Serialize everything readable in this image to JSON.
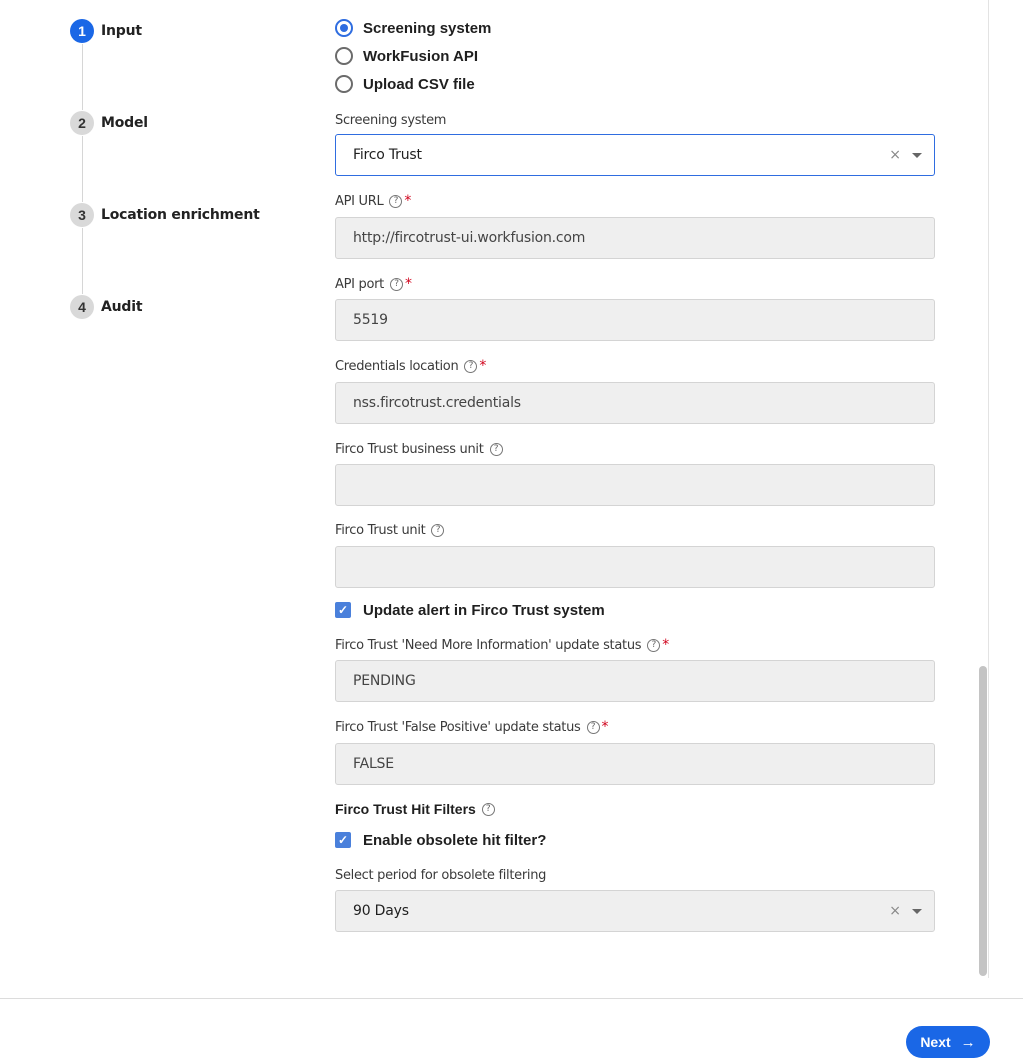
{
  "stepper": {
    "steps": [
      {
        "number": "1",
        "label": "Input",
        "active": true
      },
      {
        "number": "2",
        "label": "Model",
        "active": false
      },
      {
        "number": "3",
        "label": "Location enrichment",
        "active": false
      },
      {
        "number": "4",
        "label": "Audit",
        "active": false
      }
    ]
  },
  "source": {
    "options": [
      {
        "label": "Screening system",
        "selected": true
      },
      {
        "label": "WorkFusion API",
        "selected": false
      },
      {
        "label": "Upload CSV file",
        "selected": false
      }
    ]
  },
  "fields": {
    "screening_system": {
      "label": "Screening system",
      "value": "Firco Trust"
    },
    "api_url": {
      "label": "API URL",
      "value": "http://fircotrust-ui.workfusion.com",
      "required": "*"
    },
    "api_port": {
      "label": "API port",
      "value": "5519",
      "required": "*"
    },
    "credentials": {
      "label": "Credentials location",
      "value": "nss.fircotrust.credentials",
      "required": "*"
    },
    "business_unit": {
      "label": "Firco Trust business unit",
      "value": ""
    },
    "unit": {
      "label": "Firco Trust unit",
      "value": ""
    },
    "update_alert": {
      "label": "Update alert in Firco Trust system",
      "checked": true
    },
    "need_more_info": {
      "label": "Firco Trust 'Need More Information' update status",
      "value": "PENDING",
      "required": "*"
    },
    "false_positive": {
      "label": "Firco Trust 'False Positive' update status",
      "value": "FALSE",
      "required": "*"
    },
    "hit_filters_title": "Firco Trust Hit Filters",
    "obsolete_filter": {
      "label": "Enable obsolete hit filter?",
      "checked": true
    },
    "period": {
      "label": "Select period for obsolete filtering",
      "value": "90 Days"
    }
  },
  "icons": {
    "help": "?",
    "clear": "×",
    "check": "✓",
    "arrow": "→"
  },
  "footer": {
    "next_label": "Next"
  },
  "colors": {
    "accent": "#1a67e6",
    "required": "#d0021b",
    "checkbox": "#4a80db"
  }
}
